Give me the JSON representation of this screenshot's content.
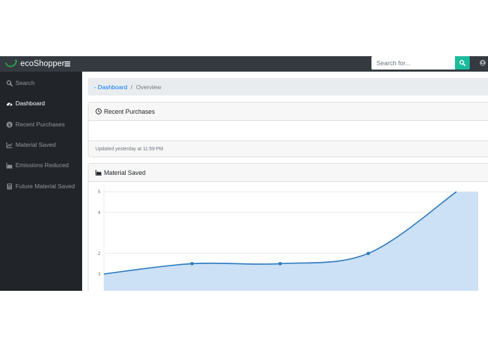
{
  "brand": {
    "name": "ecoShopper",
    "logo_icon": "leaf-swoosh-icon",
    "logo_color": "#2e9e48"
  },
  "search": {
    "placeholder": "Search for...",
    "button_icon": "search-icon",
    "button_color": "#1abc9c"
  },
  "user": {
    "icon": "user-circle-icon"
  },
  "sidebar": {
    "items": [
      {
        "label": "Search",
        "icon": "search-icon",
        "active": false
      },
      {
        "label": "Dashboard",
        "icon": "dashboard-gauge-icon",
        "active": true
      },
      {
        "label": "Recent Purchases",
        "icon": "dollar-circle-icon",
        "active": false
      },
      {
        "label": "Material Saved",
        "icon": "line-chart-icon",
        "active": false
      },
      {
        "label": "Emissions Reduced",
        "icon": "area-chart-icon",
        "active": false
      },
      {
        "label": "Future Material Saved",
        "icon": "calculator-icon",
        "active": false
      }
    ]
  },
  "breadcrumb": {
    "link": "- Dashboard",
    "separator": "/",
    "current": "Overview"
  },
  "recent_purchases": {
    "title": "Recent Purchases",
    "icon": "clock-icon",
    "footer": "Updated yesterday at 11:59 PM"
  },
  "material_saved": {
    "title": "Material Saved",
    "icon": "area-chart-icon"
  },
  "chart_data": {
    "type": "area",
    "title": "",
    "xlabel": "",
    "ylabel": "",
    "x": [
      0,
      1,
      2,
      3,
      4
    ],
    "series": [
      {
        "values": [
          1,
          1.5,
          1.5,
          2,
          5
        ]
      }
    ],
    "yticks": [
      "5",
      "4",
      "2",
      "1"
    ],
    "ylim": [
      1,
      5
    ],
    "line_color": "#2f7bbf",
    "fill_color": "#cce1f6",
    "grid": true
  }
}
